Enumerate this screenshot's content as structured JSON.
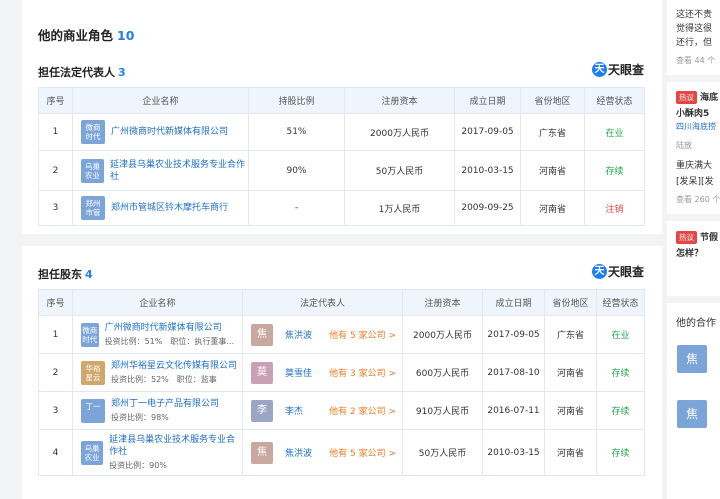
{
  "section_title": "他的商业角色",
  "section_count": "10",
  "logo_text": "天眼查",
  "legal_rep": {
    "title": "担任法定代表人",
    "count": "3",
    "headers": [
      "序号",
      "企业名称",
      "持股比例",
      "注册资本",
      "成立日期",
      "省份地区",
      "经营状态"
    ],
    "rows": [
      {
        "no": "1",
        "badge": "微商时代",
        "badge_color": "#7ba4d8",
        "name": "广州微商时代新媒体有限公司",
        "share": "51%",
        "capital": "2000万人民币",
        "date": "2017-09-05",
        "region": "广东省",
        "status": "在业",
        "status_type": "green"
      },
      {
        "no": "2",
        "badge": "乌巢农业",
        "badge_color": "#7ba4d8",
        "name": "延津县乌巢农业技术服务专业合作社",
        "share": "90%",
        "capital": "50万人民币",
        "date": "2010-03-15",
        "region": "河南省",
        "status": "存续",
        "status_type": "green"
      },
      {
        "no": "3",
        "badge": "郑州市管",
        "badge_color": "#7ba4d8",
        "name": "郑州市管城区钤木摩托车商行",
        "share": "-",
        "capital": "1万人民币",
        "date": "2009-09-25",
        "region": "河南省",
        "status": "注销",
        "status_type": "red"
      }
    ]
  },
  "shareholder": {
    "title": "担任股东",
    "count": "4",
    "headers": [
      "序号",
      "企业名称",
      "法定代表人",
      "注册资本",
      "成立日期",
      "省份地区",
      "经营状态"
    ],
    "rows": [
      {
        "no": "1",
        "badge": "微商时代",
        "badge_color": "#7ba4d8",
        "name": "广州微商时代新媒体有限公司",
        "sub1": "投资比例：51%",
        "sub2": "职位：执行董事...",
        "avatar": "焦",
        "avatar_color": "#c9a8a0",
        "person": "焦洪波",
        "more": "他有 5 家公司 >",
        "capital": "2000万人民币",
        "date": "2017-09-05",
        "region": "广东省",
        "status": "在业"
      },
      {
        "no": "2",
        "badge": "华裕星云",
        "badge_color": "#d0a86c",
        "name": "郑州华裕星云文化传媒有限公司",
        "sub1": "投资比例：52%",
        "sub2": "职位：监事",
        "avatar": "莫",
        "avatar_color": "#c9a0b5",
        "person": "莫雪佳",
        "more": "他有 3 家公司 >",
        "capital": "600万人民币",
        "date": "2017-08-10",
        "region": "河南省",
        "status": "存续"
      },
      {
        "no": "3",
        "badge": "丁一",
        "badge_color": "#7ba4d8",
        "name": "郑州丁一电子产品有限公司",
        "sub1": "投资比例：98%",
        "sub2": "",
        "avatar": "李",
        "avatar_color": "#9aa6c4",
        "person": "李杰",
        "more": "他有 2 家公司 >",
        "capital": "910万人民币",
        "date": "2016-07-11",
        "region": "河南省",
        "status": "存续"
      },
      {
        "no": "4",
        "badge": "乌巢农业",
        "badge_color": "#7ba4d8",
        "name": "延津县乌巢农业技术服务专业合作社",
        "sub1": "投资比例：90%",
        "sub2": "",
        "avatar": "焦",
        "avatar_color": "#c9a8a0",
        "person": "焦洪波",
        "more": "他有 5 家公司 >",
        "capital": "50万人民币",
        "date": "2010-03-15",
        "region": "河南省",
        "status": "存续"
      }
    ]
  },
  "sidebar": {
    "line1": "这还不贵",
    "line2": "觉得这很",
    "line3": "还行，但",
    "views1": "查看 44 个",
    "tag1": "热议",
    "t1": "海底",
    "t2": "小酥肉5",
    "t3": "四川海底捞",
    "user": "陆放",
    "t4": "重庆满大",
    "t5": "[发呆][发",
    "views2": "查看 260 个",
    "tag2": "热议",
    "t6": "节假",
    "t7": "怎样？",
    "partner_title": "他的合作",
    "av1": "焦",
    "av2": "焦"
  }
}
